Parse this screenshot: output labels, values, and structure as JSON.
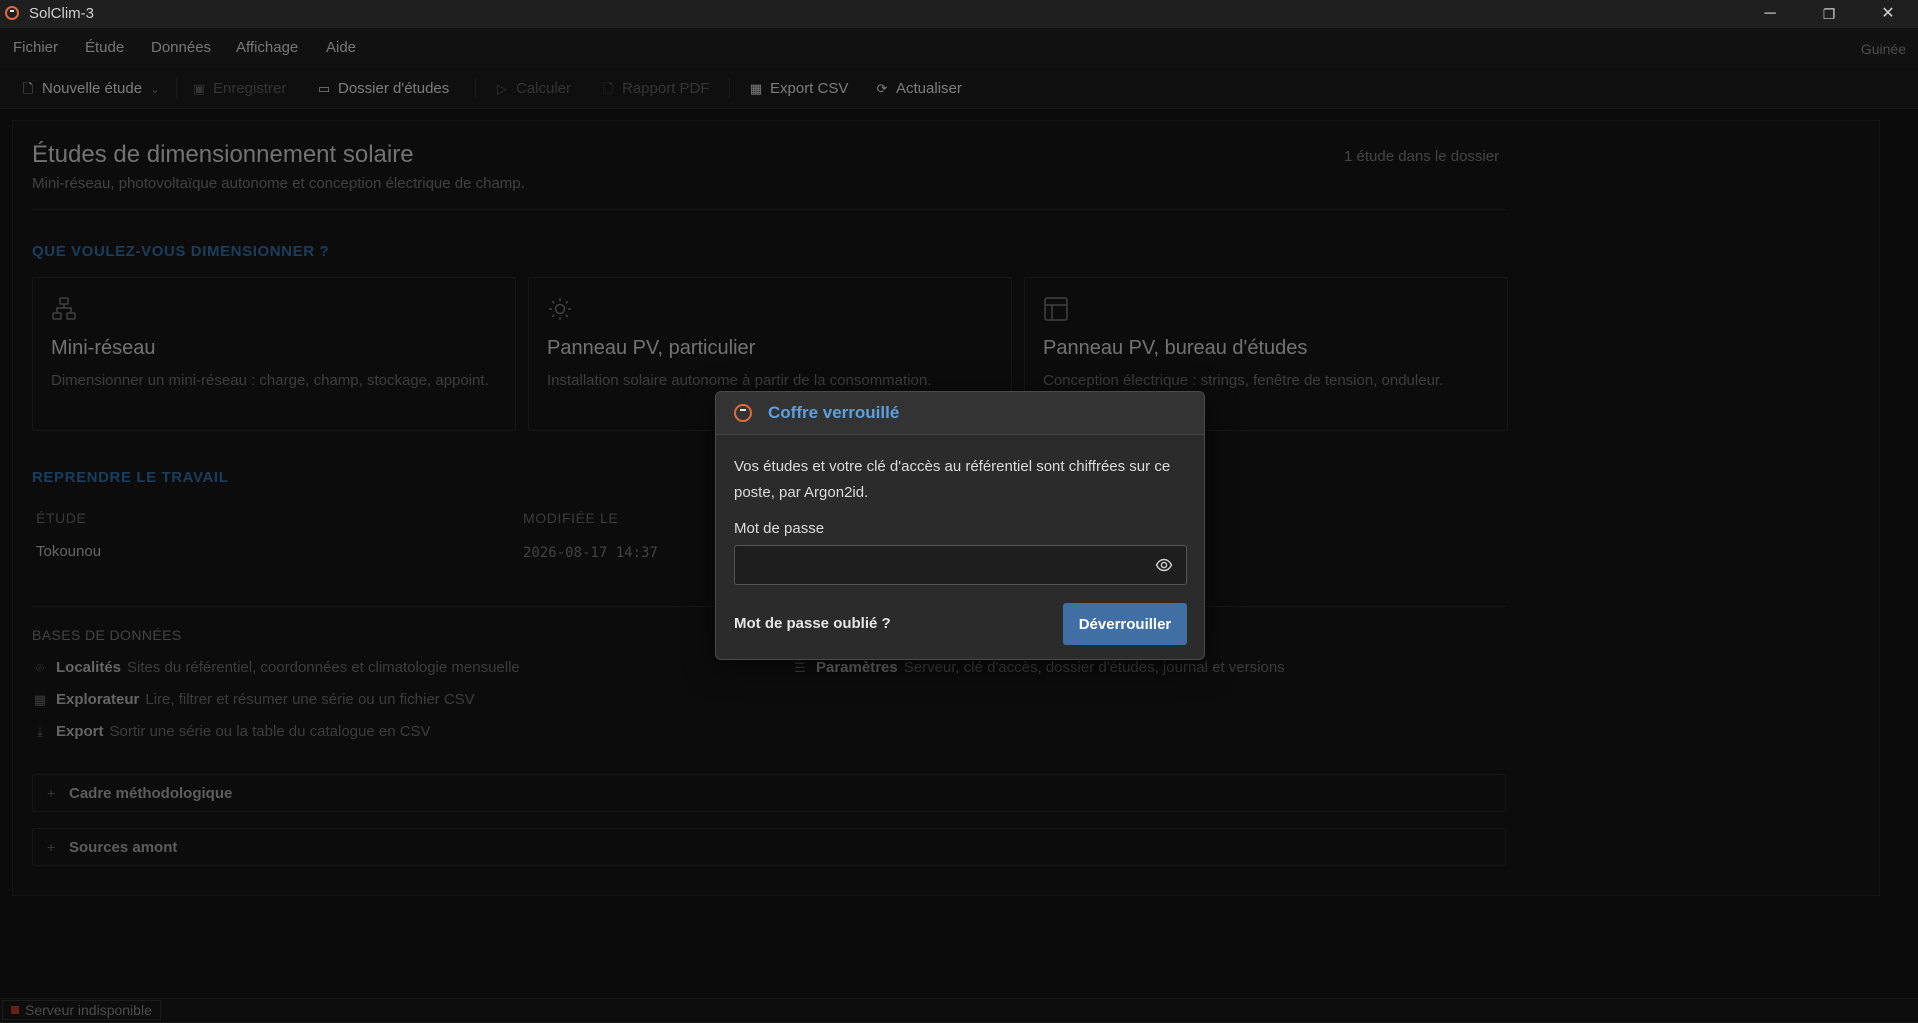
{
  "window": {
    "title": "SolClim-3",
    "controls": [
      "─",
      "❐",
      "✕"
    ]
  },
  "menu": {
    "items": [
      "Fichier",
      "Étude",
      "Données",
      "Affichage",
      "Aide"
    ],
    "region": "Guinée"
  },
  "toolbar": {
    "new_study": "Nouvelle étude",
    "save": "Enregistrer",
    "folder": "Dossier d'études",
    "compute": "Calculer",
    "report": "Rapport PDF",
    "export_csv": "Export CSV",
    "refresh": "Actualiser"
  },
  "page": {
    "title": "Études de dimensionnement solaire",
    "subtitle": "Mini-réseau, photovoltaïque autonome et conception électrique de champ.",
    "count": "1 étude dans le dossier"
  },
  "dimension": {
    "heading": "QUE VOULEZ-VOUS DIMENSIONNER ?",
    "cards": [
      {
        "title": "Mini-réseau",
        "desc": "Dimensionner un mini-réseau : charge, champ, stockage, appoint.",
        "icon": "network-icon"
      },
      {
        "title": "Panneau PV, particulier",
        "desc": "Installation solaire autonome à partir de la consommation.",
        "icon": "sun-icon"
      },
      {
        "title": "Panneau PV, bureau d'études",
        "desc": "Conception électrique : strings, fenêtre de tension, onduleur.",
        "icon": "layout-icon"
      }
    ]
  },
  "resume": {
    "heading": "REPRENDRE LE TRAVAIL",
    "columns": [
      "ÉTUDE",
      "MODIFIÉE LE"
    ],
    "rows": [
      {
        "study": "Tokounou",
        "modified": "2026-08-17 14:37"
      }
    ]
  },
  "databases": {
    "heading": "BASES DE DONNÉES",
    "items": [
      {
        "label": "Localités",
        "desc": "Sites du référentiel, coordonnées et climatologie mensuelle",
        "icon": "map-pin-icon"
      },
      {
        "label": "Explorateur",
        "desc": "Lire, filtrer et résumer une série ou un fichier CSV",
        "icon": "table-icon"
      },
      {
        "label": "Export",
        "desc": "Sortir une série ou la table du catalogue en CSV",
        "icon": "download-icon"
      },
      {
        "label": "Paramètres",
        "desc": "Serveur, clé d'accès, dossier d'études, journal et versions",
        "icon": "settings-icon"
      }
    ]
  },
  "accordions": [
    {
      "label": "Cadre méthodologique"
    },
    {
      "label": "Sources amont"
    }
  ],
  "modal": {
    "title": "Coffre verrouillé",
    "text": "Vos études et votre clé d'accès au référentiel sont chiffrées sur ce poste, par Argon2id.",
    "password_label": "Mot de passe",
    "password_value": "",
    "forgot": "Mot de passe oublié ?",
    "unlock": "Déverrouiller"
  },
  "status": {
    "text": "Serveur indisponible",
    "color": "#c0392b"
  },
  "colors": {
    "accent": "#3f6fa3",
    "heading": "#2f6fa8",
    "modal_title": "#5da0e0",
    "logo": "#e06a3b"
  }
}
